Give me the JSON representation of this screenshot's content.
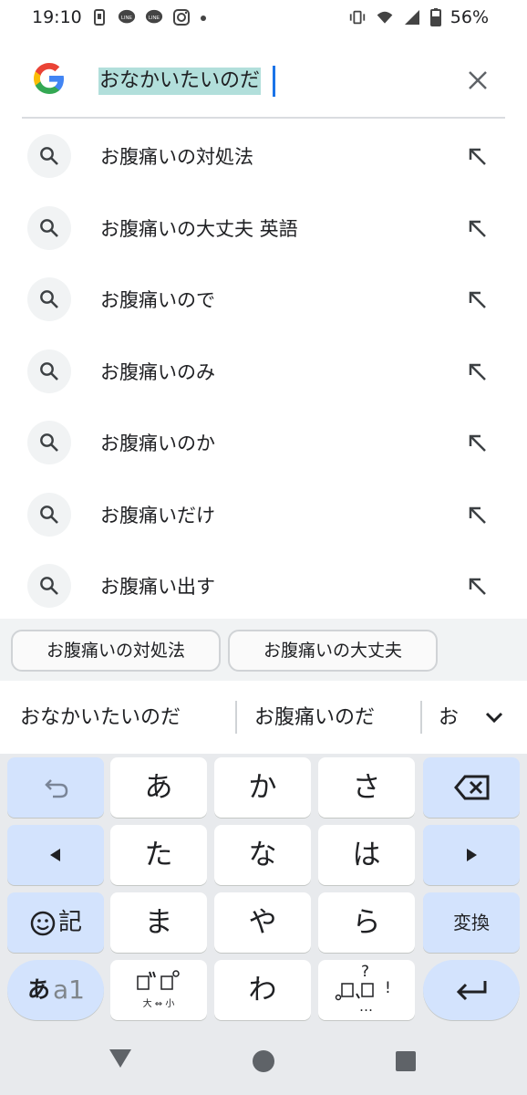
{
  "status_bar": {
    "time": "19:10",
    "left_icons": [
      "sim-icon",
      "line-icon",
      "line-icon",
      "instagram-icon",
      "dot-icon"
    ],
    "right_icons": [
      "vibrate-icon",
      "wifi-icon",
      "signal-icon",
      "battery-icon"
    ],
    "battery": "56%"
  },
  "search": {
    "logo": "google-g-logo",
    "query": "おなかいたいのだ",
    "clear_icon": "close-icon"
  },
  "suggestions": [
    {
      "label": "お腹痛いの対処法"
    },
    {
      "label": "お腹痛いの大丈夫 英語"
    },
    {
      "label": "お腹痛いので"
    },
    {
      "label": "お腹痛いのみ"
    },
    {
      "label": "お腹痛いのか"
    },
    {
      "label": "お腹痛いだけ"
    },
    {
      "label": "お腹痛い出す"
    }
  ],
  "chips": [
    "お腹痛いの対処法",
    "お腹痛いの大丈夫"
  ],
  "candidates": [
    "おなかいたいのだ",
    "お腹痛いのだ",
    "お"
  ],
  "keyboard": {
    "row1": [
      "undo",
      "あ",
      "か",
      "さ",
      "backspace"
    ],
    "row2": [
      "left",
      "た",
      "な",
      "は",
      "right"
    ],
    "row3": [
      "☺記",
      "ま",
      "や",
      "ら",
      "変換"
    ],
    "row4": [
      "あa1",
      "゛゜",
      "わ",
      "？、。！",
      "enter"
    ],
    "mode_label_kana": "あ",
    "mode_label_alpha": "a1",
    "emoji_label": "記",
    "dakuten_sub": "大 ⇔ 小",
    "punct_top": "?",
    "punct_bottom": "…",
    "punct_bang": "!"
  },
  "colors": {
    "accent": "#1a73e8",
    "highlight": "#b2dfdb",
    "func_key": "#d3e3fd",
    "kb_bg": "#e8eaed"
  }
}
